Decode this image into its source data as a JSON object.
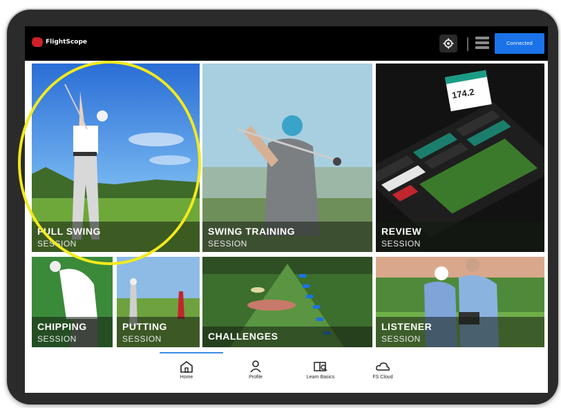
{
  "app": {
    "brand": "FlightScope"
  },
  "header": {
    "settings_icon": "gear-icon",
    "unit_icon": "unit-icon",
    "connected_label": "Connected",
    "accent_color": "#1a73e8"
  },
  "tiles": {
    "full_swing": {
      "title": "FULL SWING",
      "subtitle": "SESSION"
    },
    "swing_training": {
      "title": "SWING TRAINING",
      "subtitle": "SESSION"
    },
    "review": {
      "title": "REVIEW",
      "subtitle": "SESSION",
      "card_value": "174.2"
    },
    "chipping": {
      "title": "CHIPPING",
      "subtitle": "SESSION"
    },
    "putting": {
      "title": "PUTTING",
      "subtitle": "SESSION"
    },
    "challenges": {
      "title": "CHALLENGES"
    },
    "listener": {
      "title": "LISTENER",
      "subtitle": "SESSION"
    }
  },
  "nav": {
    "items": [
      {
        "label": "Home",
        "icon": "home-icon"
      },
      {
        "label": "Profile",
        "icon": "person-icon"
      },
      {
        "label": "Learn Basics",
        "icon": "book-icon"
      },
      {
        "label": "FS Cloud",
        "icon": "cloud-icon"
      }
    ],
    "active": "Home"
  },
  "annotation": {
    "highlight_color": "#f4ea1c"
  }
}
